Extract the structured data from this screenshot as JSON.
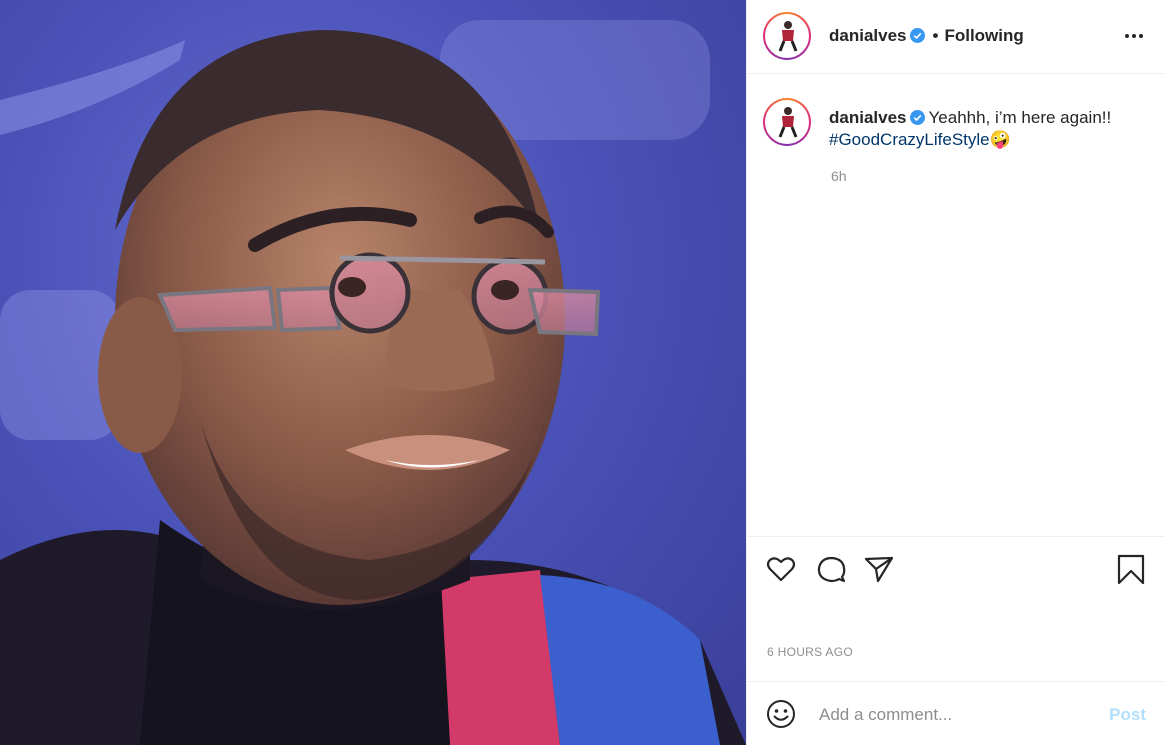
{
  "post": {
    "username": "danialves",
    "separator": "•",
    "follow_status": "Following",
    "caption": {
      "username": "danialves",
      "text": "Yeahhh, i’m here again!!",
      "hashtag": "#GoodCrazyLifeStyle",
      "emoji": "🤪",
      "time": "6h"
    },
    "date": "6 HOURS AGO",
    "comment_placeholder": "Add a comment...",
    "post_button": "Post"
  },
  "icons": {
    "more": "more-options-icon",
    "verified": "verified-badge-icon",
    "like": "heart-icon",
    "comment": "comment-bubble-icon",
    "share": "paper-plane-icon",
    "save": "bookmark-icon",
    "emoji": "smiley-icon"
  },
  "colors": {
    "verified": "#3897f0",
    "hashtag": "#00376b",
    "muted": "#8e8e8e",
    "post_disabled": "#b2dffc",
    "photo_background": "#4a52b8"
  }
}
